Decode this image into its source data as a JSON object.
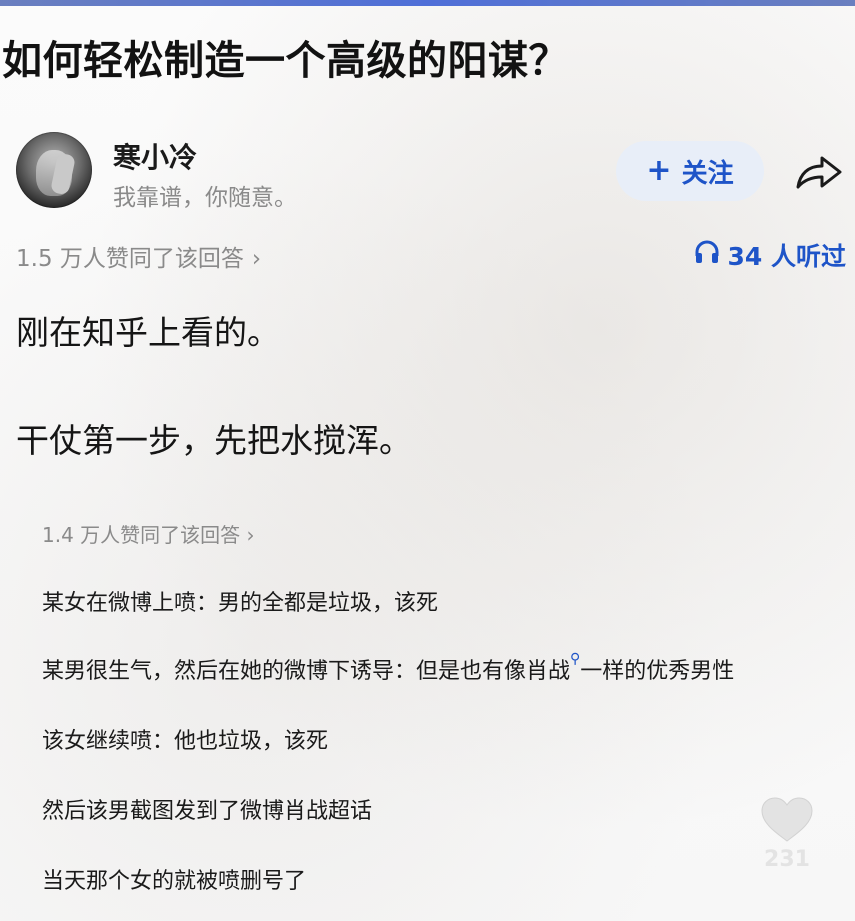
{
  "question": {
    "title": "如何轻松制造一个高级的阳谋？"
  },
  "author": {
    "name": "寒小冷",
    "bio": "我靠谱，你随意。"
  },
  "actions": {
    "follow_label": "关注",
    "follow_icon": "plus-icon",
    "share_icon": "share-icon",
    "accent_color": "#1e54c8",
    "follow_bg": "#e8eef8"
  },
  "meta": {
    "upvotes": "1.5 万人赞同了该回答",
    "upvotes_chevron": "›",
    "listened": "34 人听过",
    "listened_icon": "headphones-icon"
  },
  "answer": {
    "paragraphs": [
      "刚在知乎上看的。",
      "干仗第一步，先把水搅浑。"
    ]
  },
  "embedded": {
    "upvotes": "1.4 万人赞同了该回答",
    "upvotes_chevron": "›",
    "lines": [
      "某女在微博上喷：男的全都是垃圾，该死",
      "某男很生气，然后在她的微博下诱导：但是也有像",
      "该女继续喷：他也垃圾，该死",
      "然后该男截图发到了微博肖战超话",
      "当天那个女的就被喷删号了"
    ],
    "line2_link": "肖战",
    "line2_tail": "一样的优秀男性",
    "search_icon": "search-icon"
  },
  "like": {
    "count": "231",
    "icon": "heart-icon"
  }
}
